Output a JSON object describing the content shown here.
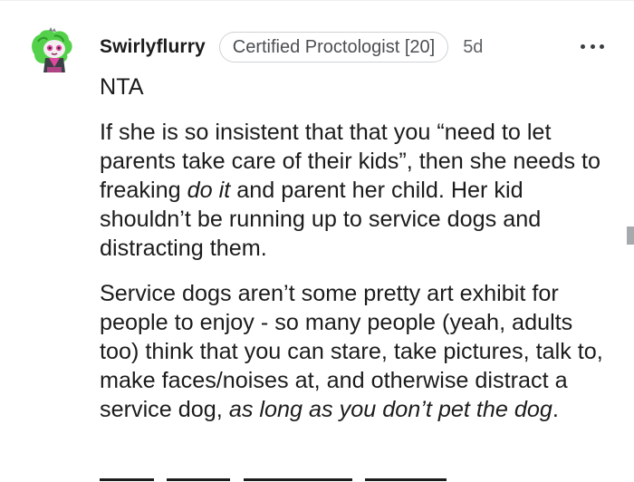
{
  "comment": {
    "username": "Swirlyflurry",
    "flair": "Certified Proctologist [20]",
    "timestamp": "5d",
    "more_menu_icon": "more-horizontal-icon",
    "avatar_icon": "snoo-avatar-icon",
    "paragraphs": [
      {
        "parts": [
          {
            "text": "NTA",
            "italic": false
          }
        ]
      },
      {
        "parts": [
          {
            "text": "If she is so insistent that that you “need to let parents take care of their kids”, then she needs to freaking ",
            "italic": false
          },
          {
            "text": "do it",
            "italic": true
          },
          {
            "text": " and parent her child. Her kid shouldn’t be running up to service dogs and distracting them.",
            "italic": false
          }
        ]
      },
      {
        "parts": [
          {
            "text": "Service dogs aren’t some pretty art exhibit for people to enjoy - so many people (yeah, adults too) think that you can stare, take pictures, talk to, make faces/noises at, and otherwise distract a service dog, ",
            "italic": false
          },
          {
            "text": "as long as you don’t pet the dog",
            "italic": true
          },
          {
            "text": ".",
            "italic": false
          }
        ]
      }
    ]
  },
  "colors": {
    "text": "#1c1c1c",
    "meta": "#5f6266",
    "flair_border": "#cfd2d4",
    "avatar_hair": "#53d14a",
    "avatar_accent": "#e0479e"
  }
}
